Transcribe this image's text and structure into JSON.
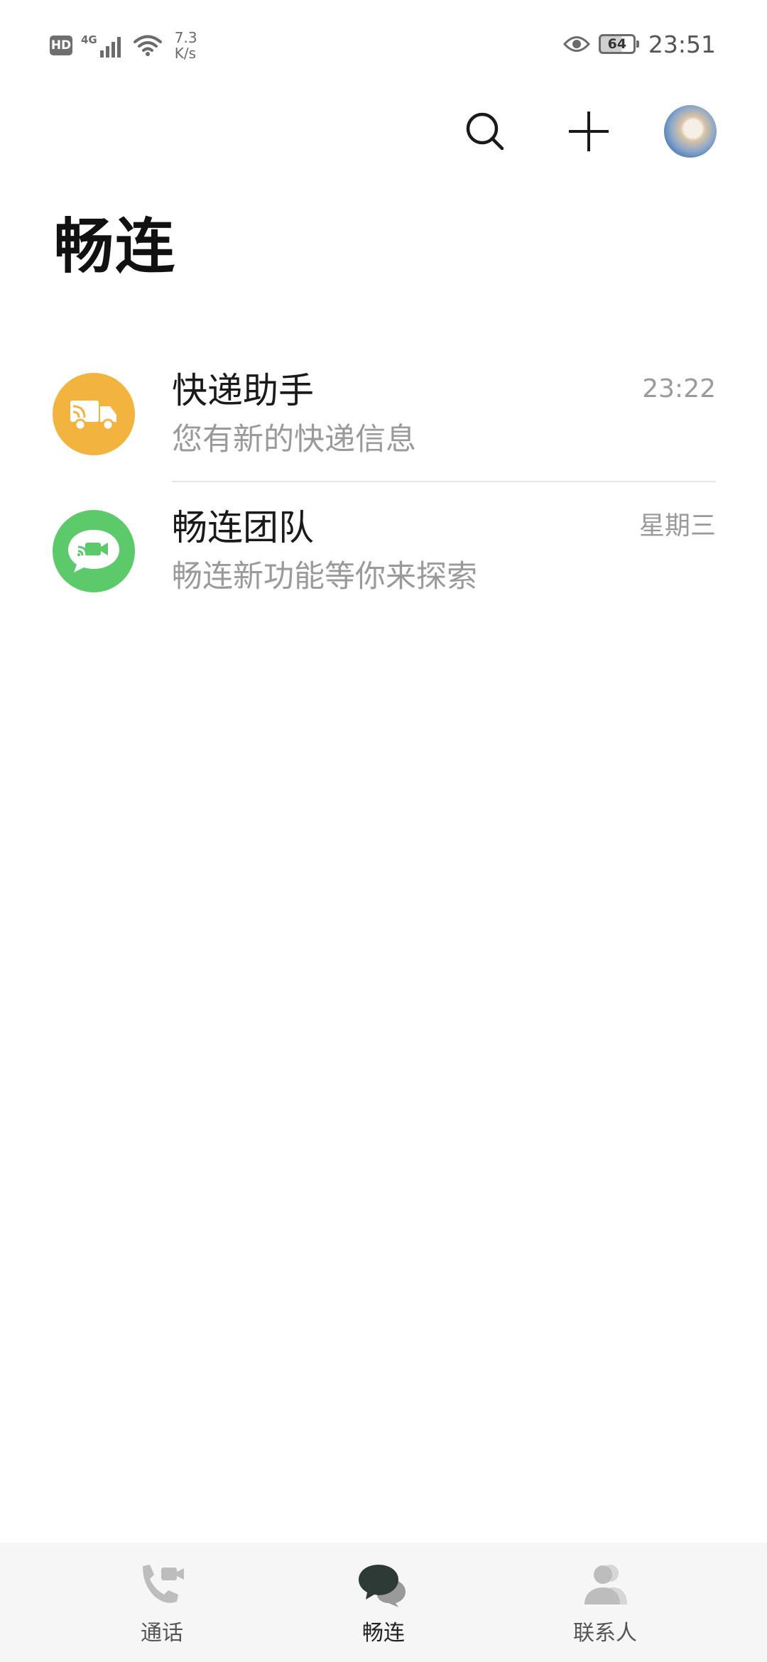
{
  "status_bar": {
    "hd_badge": "HD",
    "network_type": "4G",
    "net_speed_value": "7.3",
    "net_speed_unit": "K/s",
    "battery_level": "64",
    "time": "23:51"
  },
  "header": {
    "search_icon": "search-icon",
    "add_icon": "plus-icon",
    "title": "畅连"
  },
  "conversations": [
    {
      "title": "快递助手",
      "subtitle": "您有新的快递信息",
      "time": "23:22",
      "icon": "truck-icon",
      "color": "#F3B43F"
    },
    {
      "title": "畅连团队",
      "subtitle": "畅连新功能等你来探索",
      "time": "星期三",
      "icon": "video-chat-icon",
      "color": "#5CC96A"
    }
  ],
  "bottom_nav": {
    "items": [
      {
        "label": "通话",
        "icon": "phone-video-icon",
        "active": false
      },
      {
        "label": "畅连",
        "icon": "chat-bubbles-icon",
        "active": true
      },
      {
        "label": "联系人",
        "icon": "contacts-icon",
        "active": false
      }
    ]
  }
}
